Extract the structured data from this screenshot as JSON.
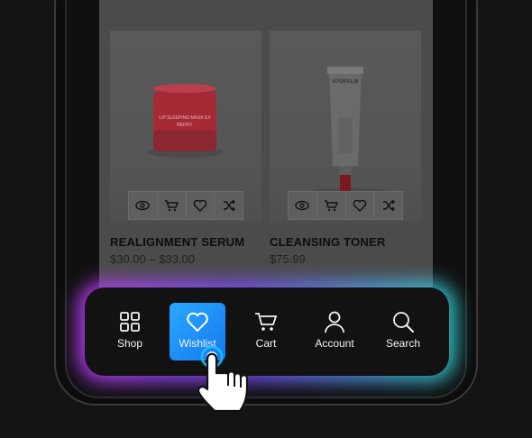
{
  "products": [
    {
      "name": "REALIGNMENT SERUM",
      "price": "$30.00 – $33.00",
      "image_icon": "lip-sleeping-mask-jar",
      "jar_label": "LIP SLEEPING MASK EX",
      "jar_sublabel": "BERRY"
    },
    {
      "name": "CLEANSING TONER",
      "price": "$75.99",
      "image_icon": "cream-tube",
      "tube_label": "ATOPALM"
    }
  ],
  "card_actions": [
    "eye-icon",
    "cart-icon",
    "heart-icon",
    "shuffle-icon"
  ],
  "nav": {
    "items": [
      {
        "label": "Shop",
        "icon": "grid-icon",
        "active": false
      },
      {
        "label": "Wishlist",
        "icon": "heart-icon",
        "active": true
      },
      {
        "label": "Cart",
        "icon": "cart-icon",
        "active": false
      },
      {
        "label": "Account",
        "icon": "user-icon",
        "active": false
      },
      {
        "label": "Search",
        "icon": "search-icon",
        "active": false
      }
    ]
  },
  "colors": {
    "active_tab": "#1e90ff",
    "glow_left": "#c13cff",
    "glow_right": "#2fd6d6",
    "jar": "#c8323f",
    "tube_cap": "#c8202a"
  }
}
